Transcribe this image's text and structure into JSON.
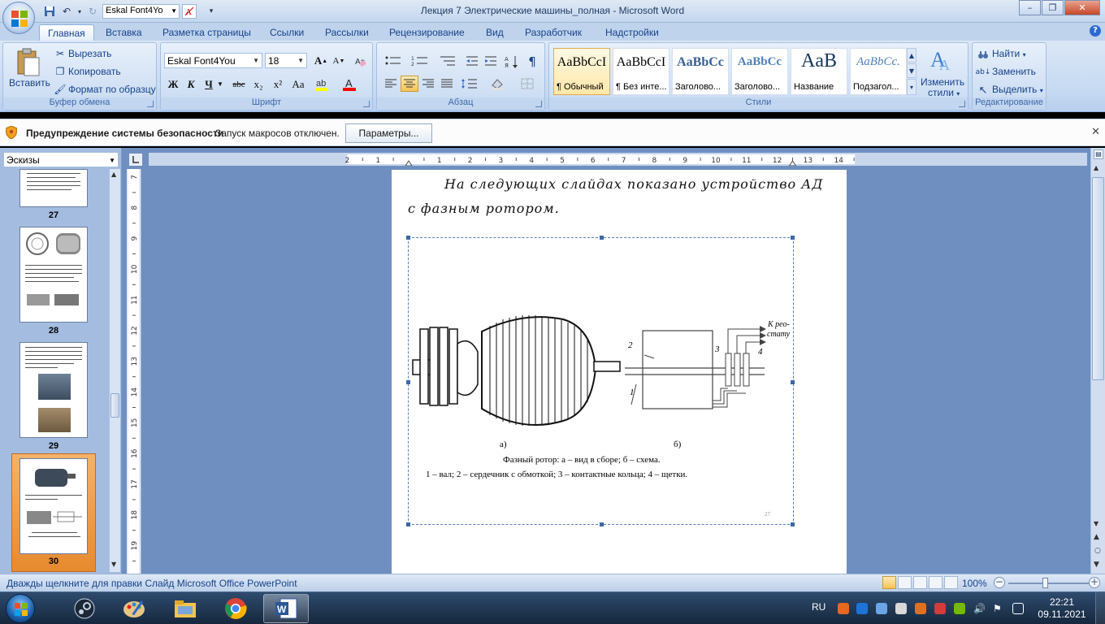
{
  "window": {
    "title": "Лекция 7 Электрические машины_полная - Microsoft Word",
    "quick_font": "Eskal Font4Yo",
    "controls": [
      "–",
      "❐",
      "✕"
    ]
  },
  "tabs": [
    "Главная",
    "Вставка",
    "Разметка страницы",
    "Ссылки",
    "Рассылки",
    "Рецензирование",
    "Вид",
    "Разработчик",
    "Надстройки"
  ],
  "ribbon": {
    "clipboard": {
      "paste": "Вставить",
      "cut": "Вырезать",
      "copy": "Копировать",
      "format_painter": "Формат по образцу",
      "label": "Буфер обмена"
    },
    "font": {
      "name": "Eskal Font4You",
      "size": "18",
      "bold": "Ж",
      "italic": "К",
      "underline": "Ч",
      "strike": "abc",
      "subscript": "x₂",
      "superscript": "x²",
      "change_case": "Aa",
      "grow": "A",
      "shrink": "A",
      "label": "Шрифт"
    },
    "paragraph": {
      "label": "Абзац"
    },
    "styles": {
      "items": [
        {
          "sample": "AaBbCcI",
          "name": "¶ Обычный"
        },
        {
          "sample": "AaBbCcI",
          "name": "¶ Без инте..."
        },
        {
          "sample": "AaBbCc",
          "name": "Заголово..."
        },
        {
          "sample": "AaBbCc",
          "name": "Заголово..."
        },
        {
          "sample": "AaB",
          "name": "Название"
        },
        {
          "sample": "AaBbCc.",
          "name": "Подзагол..."
        }
      ],
      "change": "Изменить стили",
      "change_line1": "Изменить",
      "change_line2": "стили",
      "label": "Стили"
    },
    "editing": {
      "find": "Найти",
      "replace": "Заменить",
      "select": "Выделить",
      "label": "Редактирование"
    }
  },
  "security_bar": {
    "title": "Предупреждение системы безопасности",
    "message": "Запуск макросов отключен.",
    "button": "Параметры..."
  },
  "thumbnails": {
    "view": "Эскизы",
    "pages": [
      "27",
      "28",
      "29",
      "30"
    ],
    "active": "30"
  },
  "ruler": {
    "h_ticks": [
      "2",
      "1",
      "1",
      "2",
      "3",
      "4",
      "5",
      "6",
      "7",
      "8",
      "9",
      "10",
      "11",
      "12",
      "13",
      "14"
    ],
    "v_ticks": [
      "7",
      "8",
      "9",
      "10",
      "11",
      "12",
      "13",
      "14",
      "15",
      "16",
      "17",
      "18",
      "19"
    ]
  },
  "document": {
    "line1": "На следующих слайдах показано устройство АД",
    "line2": "с фазным ротором.",
    "figure": {
      "label_a": "а)",
      "label_b": "б)",
      "caption1": "Фазный ротор: а – вид в сборе; б – схема.",
      "caption2": "1 – вал; 2 – сердечник с обмоткой; 3 – контактные кольца; 4 – щетки.",
      "to_rheostat_1": "К рео-",
      "to_rheostat_2": "стату",
      "num1": "1",
      "num2": "2",
      "num3": "3",
      "num4": "4",
      "slide_number": "27"
    }
  },
  "status": {
    "text": "Дважды щелкните для правки Слайд Microsoft Office PowerPoint",
    "zoom": "100%"
  },
  "taskbar": {
    "lang": "RU",
    "time": "22:21",
    "date": "09.11.2021"
  }
}
